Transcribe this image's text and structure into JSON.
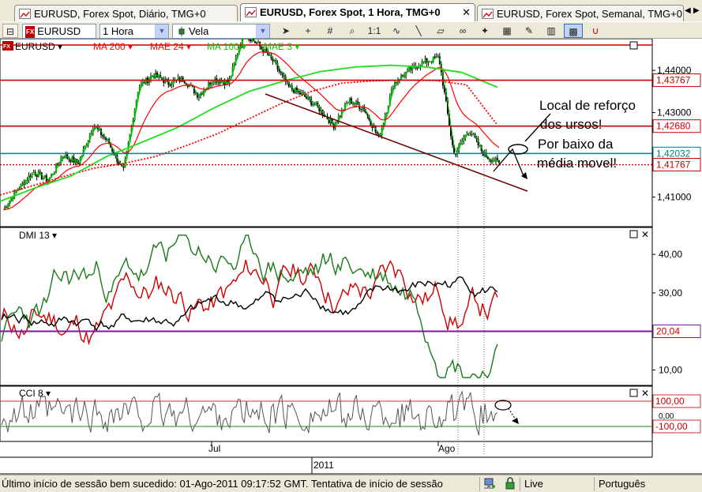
{
  "tabs": [
    {
      "label": "EURUSD, Forex Spot, Diário, TMG+0",
      "active": false
    },
    {
      "label": "EURUSD, Forex Spot, 1 Hora, TMG+0",
      "active": true
    },
    {
      "label": "EURUSD, Forex Spot, Semanal, TMG+0",
      "active": false
    }
  ],
  "toolbar": {
    "symbol": "EURUSD",
    "timeframe": "1 Hora",
    "chart_type": "Vela",
    "icons": [
      "pointer-icon",
      "crosshair-icon",
      "grid-icon",
      "zoom-icon",
      "scale-icon",
      "indicator-icon",
      "trendline-icon",
      "eraser-icon",
      "link-icon",
      "magic-icon",
      "buy-sell-icon",
      "drawing-icon",
      "bars-icon",
      "candles-icon",
      "magnet-icon"
    ]
  },
  "chart": {
    "symbol_label": "EURUSD",
    "overlays": [
      {
        "label": "MA 200",
        "color": "#ff0000"
      },
      {
        "label": "MAE 24",
        "color": "#ff0000"
      },
      {
        "label": "MA 100",
        "color": "#00cc00"
      },
      {
        "label": "MAE 3",
        "color": "#00cc00"
      }
    ],
    "price_ticks": [
      "1,44000",
      "1,43000",
      "1,41000"
    ],
    "price_levels": [
      {
        "label": "1,43767",
        "color": "#cc0000",
        "value": 1.43767
      },
      {
        "label": "1,42680",
        "color": "#cc0000",
        "value": 1.4268
      },
      {
        "label": "1,42032",
        "color": "#008080",
        "value": 1.42032
      },
      {
        "label": "1,41767",
        "color": "#cc0000",
        "value": 1.41767
      }
    ],
    "annotation_1": "Local de reforço",
    "annotation_2": "dos ursos!",
    "annotation_3": "Por baixo da",
    "annotation_4": "média movel!",
    "dmi_label": "DMI 13",
    "dmi_ticks": [
      "40,00",
      "30,00",
      "10,00"
    ],
    "dmi_level": "20,04",
    "cci_label": "CCI 8",
    "cci_ticks": [
      "100,00",
      "0,00",
      "-100,00"
    ],
    "x_labels": [
      "Jul",
      "Ago"
    ],
    "year_label": "2011"
  },
  "chart_data": {
    "type": "line",
    "title": "EURUSD, Forex Spot, 1 Hora, TMG+0",
    "ylim": [
      1.403,
      1.4475
    ],
    "x": [
      "Jul",
      "Ago"
    ],
    "series": [
      {
        "name": "EURUSD",
        "values": [
          1.407,
          1.412,
          1.416,
          1.414,
          1.42,
          1.418,
          1.427,
          1.423,
          1.416,
          1.436,
          1.439,
          1.437,
          1.438,
          1.434,
          1.438,
          1.437,
          1.449,
          1.446,
          1.442,
          1.436,
          1.434,
          1.431,
          1.427,
          1.433,
          1.431,
          1.424,
          1.437,
          1.44,
          1.442,
          1.443,
          1.42,
          1.426,
          1.42,
          1.418
        ]
      },
      {
        "name": "MA 200",
        "values": [
          1.4105,
          1.4126,
          1.4148,
          1.4168,
          1.418,
          1.4196,
          1.4222,
          1.425,
          1.4285,
          1.432,
          1.435,
          1.437,
          1.4375,
          1.4377,
          1.4376,
          1.4366,
          1.427
        ]
      },
      {
        "name": "MA 100",
        "values": [
          1.409,
          1.4122,
          1.415,
          1.4196,
          1.423,
          1.4265,
          1.431,
          1.435,
          1.4375,
          1.4397,
          1.4408,
          1.4412,
          1.4408,
          1.4395,
          1.436
        ]
      }
    ],
    "levels": [
      1.43767,
      1.4268,
      1.42032,
      1.41767
    ]
  }
}
